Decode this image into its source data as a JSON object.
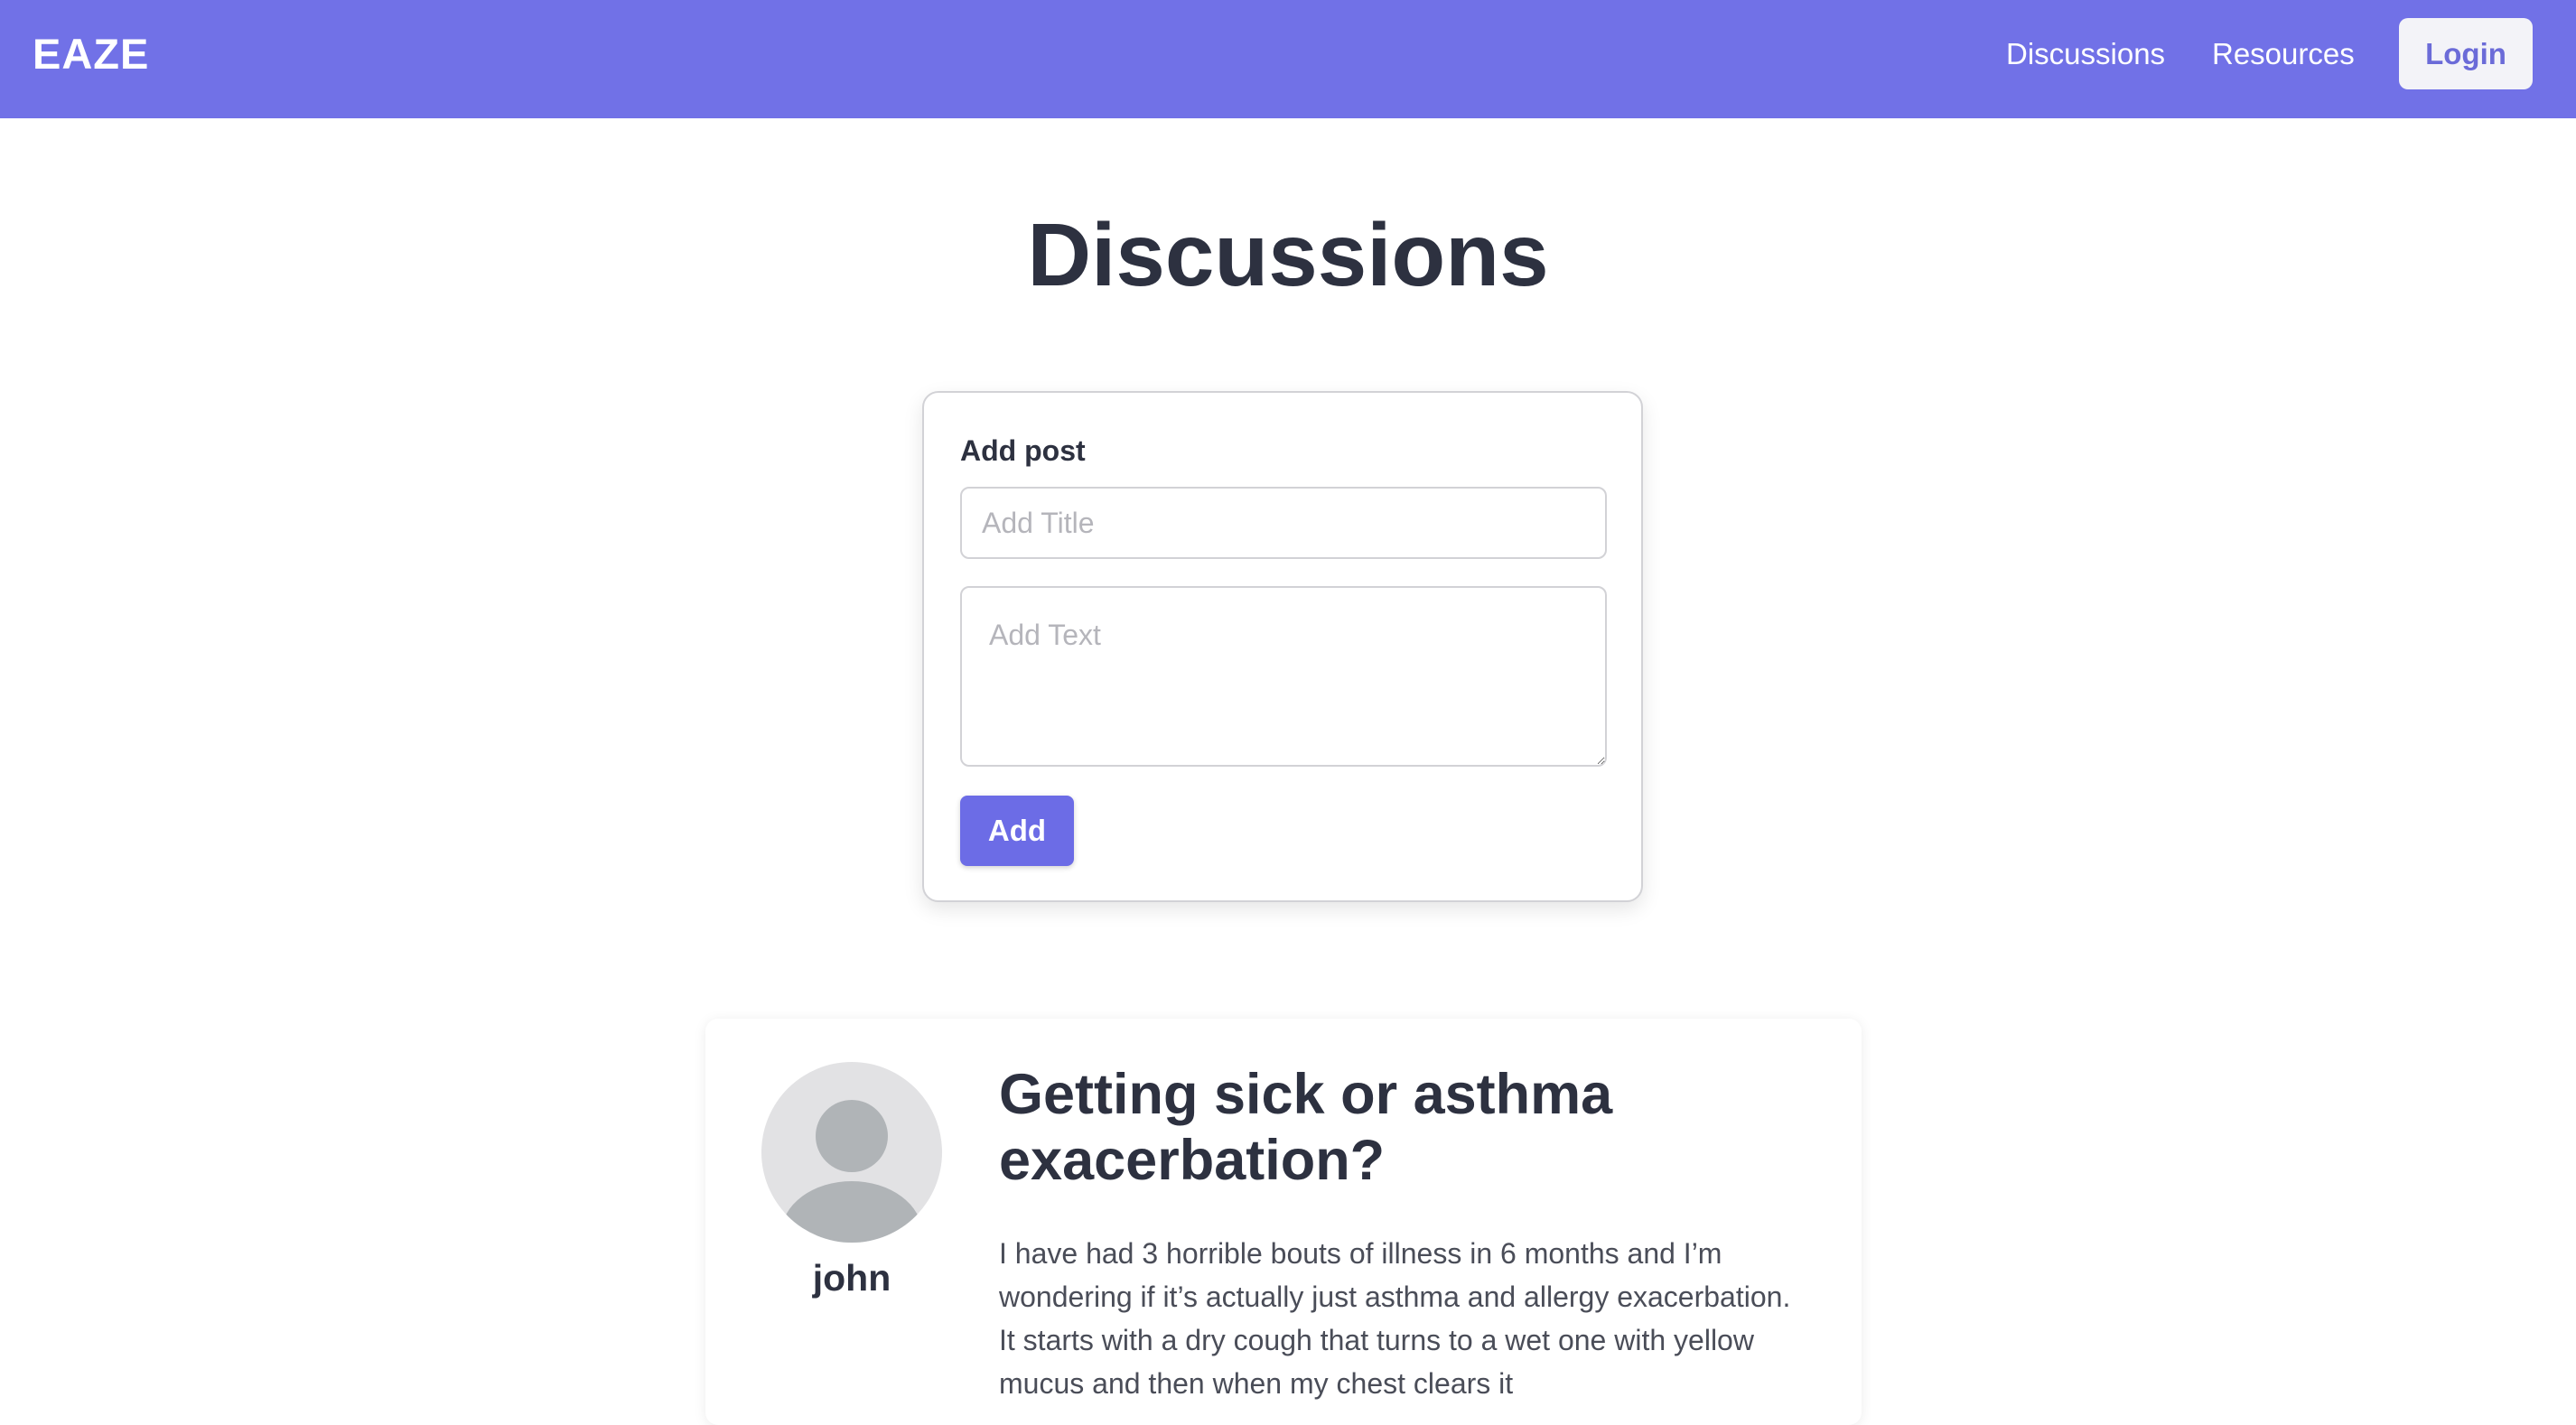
{
  "navbar": {
    "brand": "EAZE",
    "links": [
      "Discussions",
      "Resources"
    ],
    "login_label": "Login"
  },
  "page": {
    "title": "Discussions"
  },
  "add_post": {
    "label": "Add post",
    "title_placeholder": "Add Title",
    "text_placeholder": "Add Text",
    "button_label": "Add"
  },
  "posts": [
    {
      "author": "john",
      "avatar_icon": "default-user-avatar",
      "title": "Getting sick or asthma exacerbation?",
      "body": "I have had 3 horrible bouts of illness in 6 months and I’m wondering if it’s actually just asthma and allergy exacerbation. It starts with a dry cough that turns to a wet one with yellow mucus and then when my chest clears it"
    }
  ],
  "colors": {
    "primary": "#7171e7",
    "button": "#6c6ce6",
    "text_dark": "#2d3140",
    "avatar_bg": "#e2e2e4",
    "avatar_fg": "#b0b4b7"
  }
}
